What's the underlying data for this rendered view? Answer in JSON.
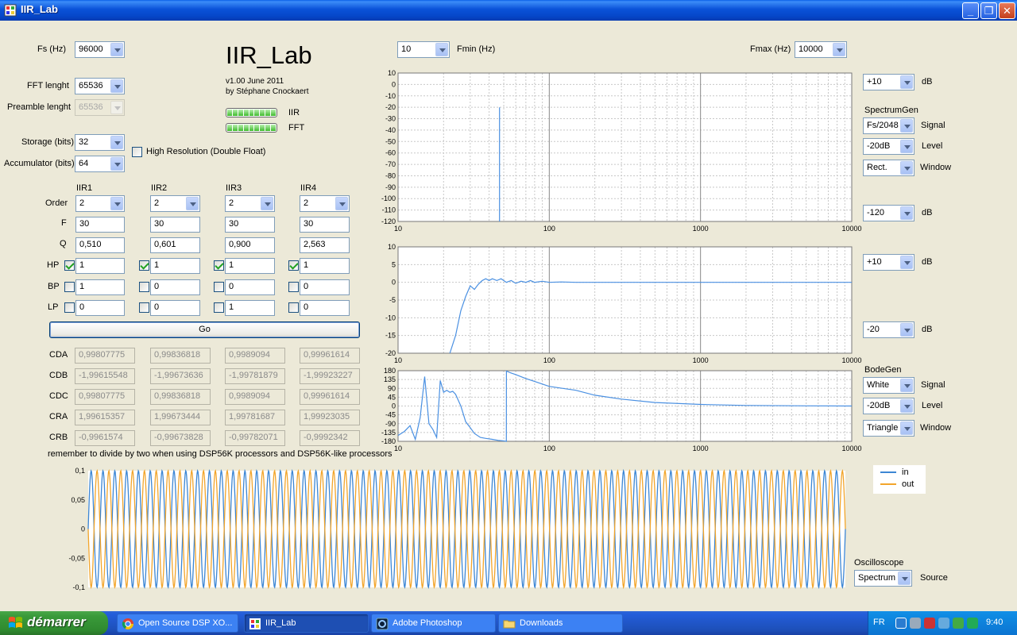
{
  "window": {
    "title": "IIR_Lab",
    "min": "_",
    "max": "❐",
    "close": "✕"
  },
  "app": {
    "title": "IIR_Lab",
    "version": "v1.00 June 2011",
    "author": "by Stéphane Cnockaert"
  },
  "settings": {
    "fs_label": "Fs (Hz)",
    "fs_value": "96000",
    "fft_label": "FFT lenght",
    "fft_value": "65536",
    "preamble_label": "Preamble lenght",
    "preamble_value": "65536",
    "storage_label": "Storage (bits)",
    "storage_value": "32",
    "accum_label": "Accumulator (bits)",
    "accum_value": "64",
    "hires_label": "High Resolution (Double Float)"
  },
  "progress": {
    "iir_label": "IIR",
    "fft_label": "FFT"
  },
  "filters": {
    "row_labels": {
      "order": "Order",
      "f": "F",
      "q": "Q",
      "hp": "HP",
      "bp": "BP",
      "lp": "LP"
    },
    "columns": [
      {
        "name": "IIR1",
        "order": "2",
        "f": "30",
        "q": "0,510",
        "hp": "1",
        "bp": "1",
        "lp": "0",
        "hp_on": true,
        "bp_on": false,
        "lp_on": false
      },
      {
        "name": "IIR2",
        "order": "2",
        "f": "30",
        "q": "0,601",
        "hp": "1",
        "bp": "0",
        "lp": "0",
        "hp_on": true,
        "bp_on": false,
        "lp_on": false
      },
      {
        "name": "IIR3",
        "order": "2",
        "f": "30",
        "q": "0,900",
        "hp": "1",
        "bp": "0",
        "lp": "1",
        "hp_on": true,
        "bp_on": false,
        "lp_on": false
      },
      {
        "name": "IIR4",
        "order": "2",
        "f": "30",
        "q": "2,563",
        "hp": "1",
        "bp": "0",
        "lp": "0",
        "hp_on": true,
        "bp_on": false,
        "lp_on": false
      }
    ]
  },
  "go_label": "Go",
  "coefs": {
    "labels": [
      "CDA",
      "CDB",
      "CDC",
      "CRA",
      "CRB"
    ],
    "values": [
      [
        "0,99807775",
        "0,99836818",
        "0,9989094",
        "0,99961614"
      ],
      [
        "-1,99615548",
        "-1,99673636",
        "-1,99781879",
        "-1,99923227"
      ],
      [
        "0,99807775",
        "0,99836818",
        "0,9989094",
        "0,99961614"
      ],
      [
        "1,99615357",
        "1,99673444",
        "1,99781687",
        "1,99923035"
      ],
      [
        "-0,9961574",
        "-0,99673828",
        "-0,99782071",
        "-0,9992342"
      ]
    ]
  },
  "note": "remember to divide by two when using DSP56K processors and DSP56K-like processors",
  "freq": {
    "fmin_value": "10",
    "fmin_label": "Fmin (Hz)",
    "fmax_label": "Fmax (Hz)",
    "fmax_value": "10000"
  },
  "right": {
    "spec_top_value": "+10",
    "db": "dB",
    "spectrumgen_label": "SpectrumGen",
    "sg_signal_value": "Fs/2048",
    "signal_label": "Signal",
    "sg_level_value": "-20dB",
    "level_label": "Level",
    "sg_window_value": "Rect.",
    "window_label": "Window",
    "spec_bottom_value": "-120",
    "mag_top_value": "+10",
    "mag_bottom_value": "-20",
    "bodegen_label": "BodeGen",
    "bg_signal_value": "White",
    "bg_level_value": "-20dB",
    "bg_window_value": "Triangle",
    "osc_label": "Oscilloscope",
    "osc_source_value": "Spectrum",
    "source_label": "Source"
  },
  "chart_data": [
    {
      "type": "line",
      "title": "",
      "x_scale": "log",
      "xlim": [
        10,
        10000
      ],
      "x_ticks": [
        "10",
        "100",
        "1000",
        "10000"
      ],
      "ylim": [
        -120,
        10
      ],
      "y_ticks": [
        "10",
        "0",
        "-10",
        "-20",
        "-30",
        "-40",
        "-50",
        "-60",
        "-70",
        "-80",
        "-90",
        "-100",
        "-110",
        "-120"
      ],
      "grid": true,
      "series": [
        {
          "color": "#4a90e2",
          "x": [
            46.9,
            46.9,
            46.9
          ],
          "y": [
            -120,
            -20,
            -120
          ]
        }
      ]
    },
    {
      "type": "line",
      "title": "",
      "x_scale": "log",
      "xlim": [
        10,
        10000
      ],
      "x_ticks": [
        "10",
        "100",
        "1000",
        "10000"
      ],
      "ylim": [
        -20,
        10
      ],
      "y_ticks": [
        "10",
        "5",
        "0",
        "-5",
        "-10",
        "-15",
        "-20"
      ],
      "grid": true,
      "series": [
        {
          "color": "#4a90e2",
          "x": [
            22,
            24,
            26,
            28,
            30,
            32,
            34,
            36,
            38,
            40,
            42,
            45,
            48,
            52,
            56,
            60,
            65,
            70,
            75,
            80,
            90,
            100,
            120,
            150,
            200,
            500,
            10000
          ],
          "y": [
            -20,
            -15,
            -8,
            -4,
            -1,
            -2,
            -0.5,
            0.5,
            1,
            0.5,
            1,
            0.5,
            1,
            0,
            0.5,
            -0.3,
            0.3,
            0,
            0.5,
            0,
            0.3,
            0,
            0.1,
            0,
            0,
            0,
            0
          ]
        }
      ]
    },
    {
      "type": "line",
      "title": "",
      "x_scale": "log",
      "xlim": [
        10,
        10000
      ],
      "x_ticks": [
        "10",
        "100",
        "1000",
        "10000"
      ],
      "ylim": [
        -180,
        180
      ],
      "y_ticks": [
        "180",
        "135",
        "90",
        "45",
        "0",
        "-45",
        "-90",
        "-135",
        "-180"
      ],
      "grid": true,
      "series": [
        {
          "color": "#4a90e2",
          "x": [
            10,
            11,
            12,
            13,
            14,
            15,
            16,
            17,
            18,
            19,
            20,
            21,
            22,
            23,
            24,
            25,
            26,
            28,
            30,
            32,
            35,
            38,
            42,
            46,
            50,
            52,
            52.1,
            55,
            60,
            70,
            80,
            100,
            150,
            200,
            300,
            500,
            1000,
            2000,
            5000,
            10000
          ],
          "y": [
            -150,
            -130,
            -100,
            -170,
            -60,
            150,
            -90,
            -120,
            -160,
            130,
            70,
            80,
            70,
            75,
            60,
            30,
            0,
            -80,
            -110,
            -140,
            -160,
            -165,
            -170,
            -175,
            -178,
            -180,
            178,
            170,
            160,
            140,
            125,
            100,
            80,
            55,
            35,
            18,
            8,
            3,
            1,
            0
          ]
        }
      ]
    },
    {
      "type": "line",
      "title": "",
      "xlim": [
        0,
        1
      ],
      "ylim": [
        -0.1,
        0.1
      ],
      "y_ticks": [
        "0,1",
        "0,05",
        "0",
        "-0,05",
        "-0,1"
      ],
      "legend": "top-right",
      "cycles": 64,
      "series": [
        {
          "name": "in",
          "color": "#3c86d4",
          "amplitude": 0.1,
          "phase_deg": 0
        },
        {
          "name": "out",
          "color": "#f2a52b",
          "amplitude": 0.1,
          "phase_deg": 180
        }
      ]
    }
  ],
  "taskbar": {
    "start": "démarrer",
    "tasks": [
      "Open Source DSP XO...",
      "IIR_Lab",
      "Adobe Photoshop",
      "Downloads"
    ],
    "lang": "FR",
    "clock": "9:40"
  }
}
